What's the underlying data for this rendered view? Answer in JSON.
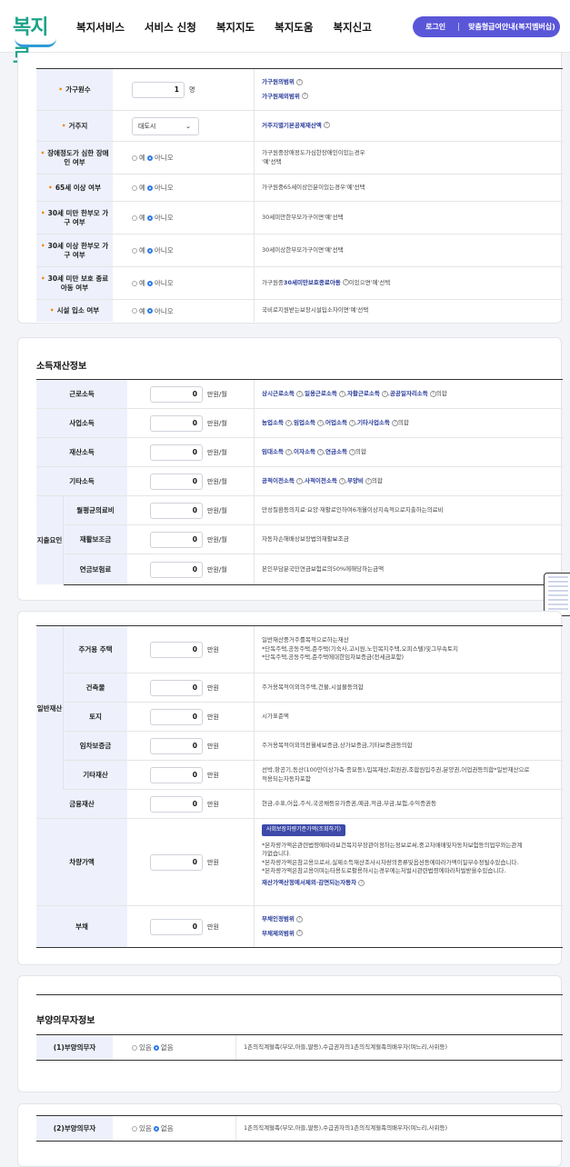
{
  "header": {
    "logo": "복지로",
    "nav": [
      "복지서비스",
      "서비스 신청",
      "복지지도",
      "복지도움",
      "복지신고"
    ],
    "login": "로그인",
    "guide": "맞춤형급여안내(복지멤버십)"
  },
  "household": {
    "rows": [
      {
        "label": "가구원수",
        "value": "1",
        "unit": "명",
        "desc_links": [
          "가구원의범위",
          "가구원제외범위"
        ]
      },
      {
        "label": "거주지",
        "select": "대도시",
        "desc_links": [
          "거주지별기본공제재산액"
        ]
      },
      {
        "label": "장애정도가 심한 장애인 여부",
        "yes": "예",
        "no": "아니오",
        "desc": [
          "가구원중장애정도가심한장애인이있는경우",
          "'예'선택"
        ]
      },
      {
        "label": "65세 이상 여부",
        "yes": "예",
        "no": "아니오",
        "desc": [
          "가구원중65세이상인분이있는경우'예'선택"
        ]
      },
      {
        "label": "30세 미만 한부모 가구 여부",
        "yes": "예",
        "no": "아니오",
        "desc": [
          "30세미만한부모가구이면'예'선택"
        ]
      },
      {
        "label": "30세 이상 한부모 가구 여부",
        "yes": "예",
        "no": "아니오",
        "desc": [
          "30세이상한부모가구이면'예'선택"
        ]
      },
      {
        "label": "30세 미만 보호 종료 아동 여부",
        "yes": "예",
        "no": "아니오",
        "desc_pre": "가구원중",
        "desc_link": "30세미만보호종료아동",
        "desc_post": "이있으면'예'선택"
      },
      {
        "label": "시설 입소 여부",
        "yes": "예",
        "no": "아니오",
        "desc": [
          "국비로지원받는보장시설입소자이면'예'선택"
        ]
      }
    ]
  },
  "income": {
    "title": "소득재산정보",
    "deduction_group": "지출요인",
    "rows": [
      {
        "label": "근로소득",
        "value": "0",
        "unit": "만원/월",
        "links": [
          "상시근로소득",
          "일용근로소득",
          "자활근로소득",
          "공공일자리소득"
        ],
        "tail": "의합"
      },
      {
        "label": "사업소득",
        "value": "0",
        "unit": "만원/월",
        "links": [
          "농업소득",
          "임업소득",
          "어업소득",
          "기타사업소득"
        ],
        "tail": "의합"
      },
      {
        "label": "재산소득",
        "value": "0",
        "unit": "만원/월",
        "links": [
          "임대소득",
          "이자소득",
          "연금소득"
        ],
        "tail": "의합"
      },
      {
        "label": "기타소득",
        "value": "0",
        "unit": "만원/월",
        "links": [
          "공적이전소득",
          "사적이전소득",
          "부양비"
        ],
        "tail": "의합"
      },
      {
        "label": "월평균의료비",
        "value": "0",
        "unit": "만원/월",
        "desc": "만성질환등의치료·요양·재활로인하여6개월이상지속적으로지출하는의료비"
      },
      {
        "label": "재활보조금",
        "value": "0",
        "unit": "만원/월",
        "desc": "자동차손해배상보장법의재활보조금"
      },
      {
        "label": "연금보험료",
        "value": "0",
        "unit": "만원/월",
        "desc": "본인부담분국민연금보험료의50%에해당하는금액"
      }
    ]
  },
  "property": {
    "group": "일반재산",
    "rows": [
      {
        "label": "주거용 주택",
        "value": "0",
        "unit": "만원",
        "desc": [
          "일반재산중거주를목적으로하는재산",
          "*단독주택,공동주택,준주택(기숙사,고시원,노인복지주택,오피스텔)및그부속토지",
          "*단독주택,공동주택,준주택에대한임차보증금(전세금포함)"
        ]
      },
      {
        "label": "건축물",
        "value": "0",
        "unit": "만원",
        "desc": [
          "주거용목적이외의주택,건물,시설물등의합"
        ]
      },
      {
        "label": "토지",
        "value": "0",
        "unit": "만원",
        "desc": [
          "시가표준액"
        ]
      },
      {
        "label": "임차보증금",
        "value": "0",
        "unit": "만원",
        "desc": [
          "주거용목적이외의전월세보증금,상가보증금,기타보증금등의합"
        ]
      },
      {
        "label": "기타재산",
        "value": "0",
        "unit": "만원",
        "desc": [
          "선박,항공기,동산(100만이상가축·종묘등),입목재산,회원권,조합원입주권,분양권,어업권등의합*일반재산으로",
          "적용되는자동차포함"
        ]
      },
      {
        "label": "금융재산",
        "value": "0",
        "unit": "만원",
        "desc": [
          "현금,수표,어음,주식,국공채등유가증권,예금,적금,부금,보험,수익증권등"
        ]
      },
      {
        "label": "차량가액",
        "value": "0",
        "unit": "만원",
        "badge": "사회보장차량기준가액(조회하기)",
        "desc": [
          "*본차량가액은관련법령에따라보건복지부장관이정하는정보로써,중고차매매및자동차보험등의업무와는관계",
          "가없습니다.",
          "*본차량가액은참고용으로서,실제소득재산조사시차량의종류및옵션등에따라가액이일부수정될수있습니다.",
          "*본차량가액은참고용이며는타용도로활용하시는경우에는처벌시관련법령에따라처벌받을수있습니다."
        ],
        "link": "재산가액산정에서제외·감면되는자동차"
      },
      {
        "label": "부채",
        "value": "0",
        "unit": "만원",
        "links": [
          "부채인정범위",
          "부채제외범위"
        ]
      }
    ]
  },
  "support1": {
    "title": "부양의무자정보",
    "label": "(1)부양의무자",
    "yes": "있음",
    "no": "없음",
    "desc": "1촌의직계혈족(부모,아들,딸등),수급권자의1촌의직계혈족의배우자(며느리,사위등)"
  },
  "support2": {
    "label": "(2)부양의무자",
    "yes": "있음",
    "no": "없음",
    "desc": "1촌의직계혈족(부모,아들,딸등),수급권자의1촌의직계혈족의배우자(며느리,사위등)"
  }
}
